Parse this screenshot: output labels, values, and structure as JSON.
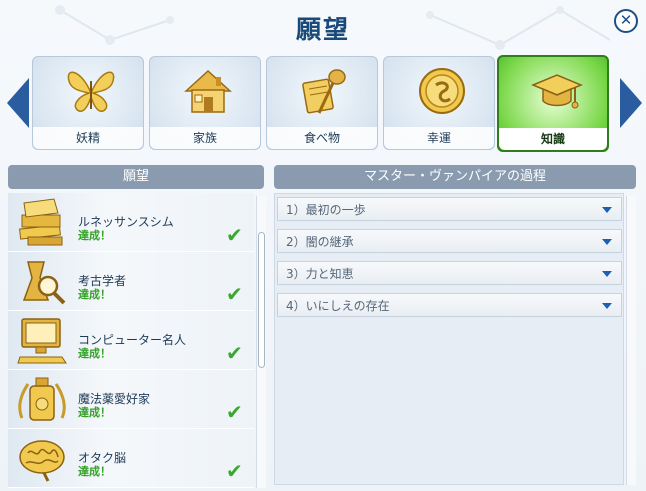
{
  "title": "願望",
  "close_label": "✕",
  "categories": [
    {
      "label": "妖精",
      "icon": "butterfly-icon"
    },
    {
      "label": "家族",
      "icon": "house-icon"
    },
    {
      "label": "食べ物",
      "icon": "food-icon"
    },
    {
      "label": "幸運",
      "icon": "coin-icon"
    },
    {
      "label": "知識",
      "icon": "graduation-cap-icon",
      "active": true
    }
  ],
  "left_panel": {
    "header": "願望",
    "items": [
      {
        "name": "ルネッサンスシム",
        "status": "達成！",
        "icon": "books-icon"
      },
      {
        "name": "考古学者",
        "status": "達成！",
        "icon": "magnifier-icon"
      },
      {
        "name": "コンピューター名人",
        "status": "達成！",
        "icon": "computer-icon"
      },
      {
        "name": "魔法薬愛好家",
        "status": "達成！",
        "icon": "potion-icon"
      },
      {
        "name": "オタク脳",
        "status": "達成！",
        "icon": "brain-icon"
      }
    ]
  },
  "right_panel": {
    "header": "マスター・ヴァンパイアの過程",
    "steps": [
      {
        "label": "1）最初の一歩"
      },
      {
        "label": "2）闇の継承"
      },
      {
        "label": "3）力と知恵"
      },
      {
        "label": "4）いにしえの存在"
      }
    ]
  },
  "colors": {
    "accent": "#2a5da0",
    "active_tab": "#5cc436",
    "success": "#36a22a",
    "header_bg": "#8a9bb0"
  }
}
